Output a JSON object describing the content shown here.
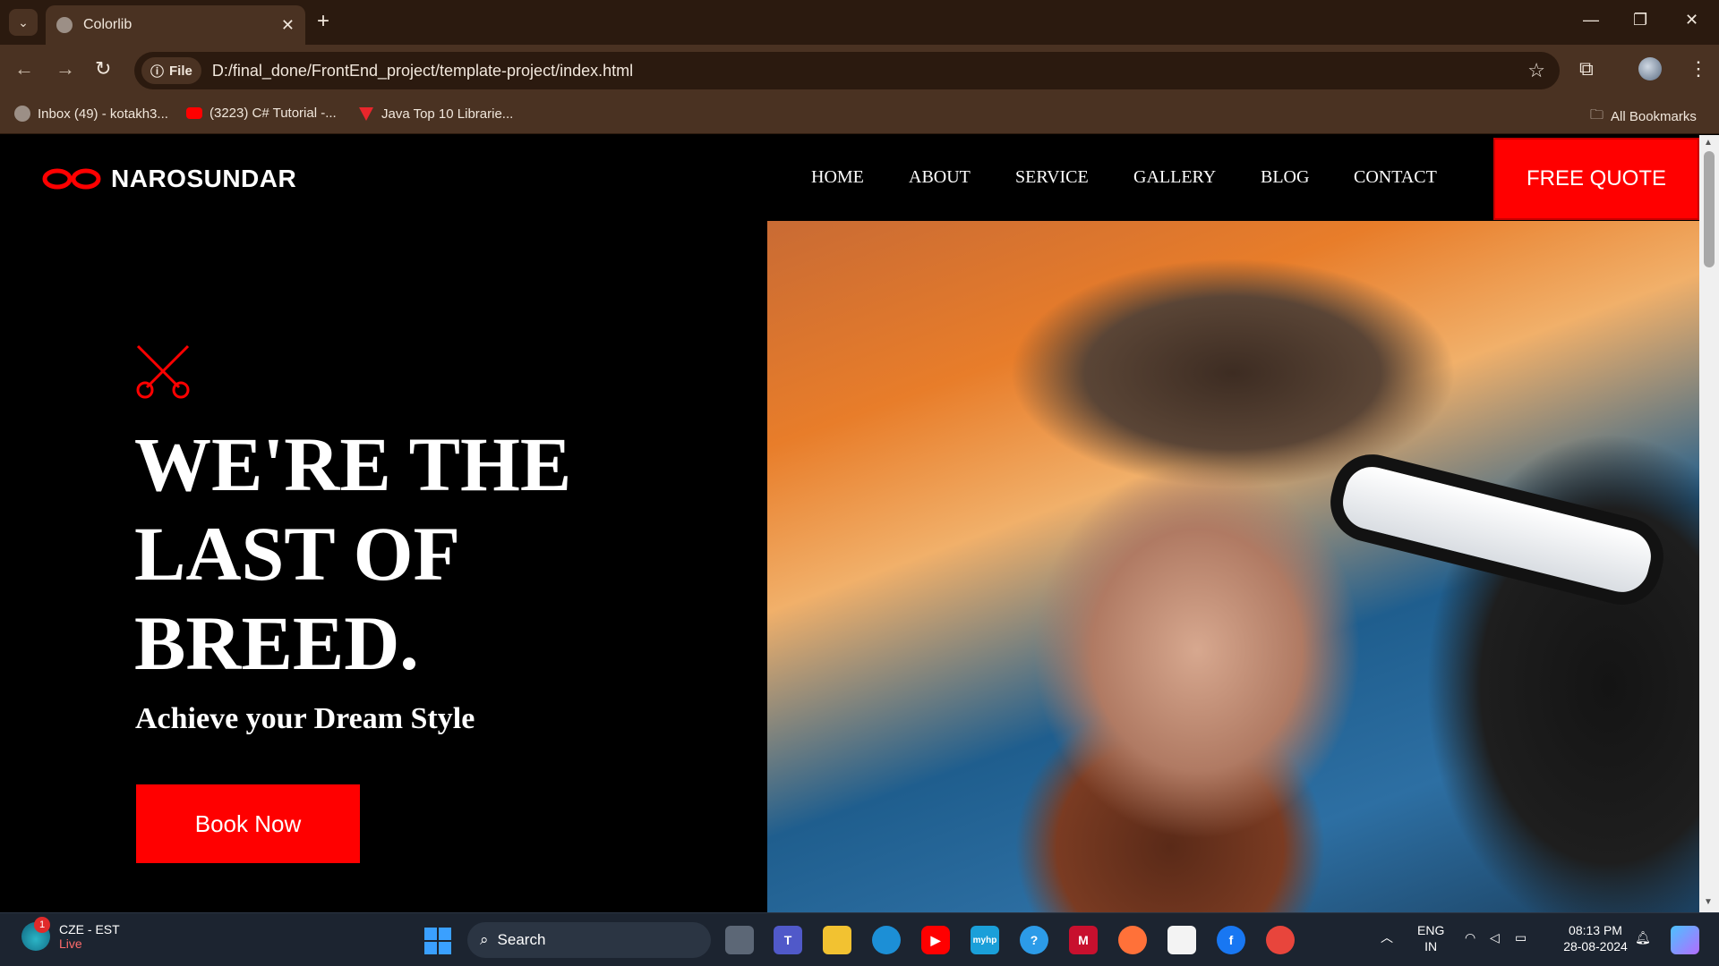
{
  "browser": {
    "tab_title": "Colorlib",
    "file_chip": "File",
    "url": "D:/final_done/FrontEnd_project/template-project/index.html",
    "bookmarks": [
      {
        "label": "Inbox (49) - kotakh3...",
        "icon": "globe-icon"
      },
      {
        "label": "(3223) C# Tutorial -...",
        "icon": "youtube-icon"
      },
      {
        "label": "Java Top 10 Librarie...",
        "icon": "vivaldi-icon"
      }
    ],
    "all_bookmarks": "All Bookmarks"
  },
  "site": {
    "brand": "NAROSUNDAR",
    "nav": [
      "HOME",
      "ABOUT",
      "SERVICE",
      "GALLERY",
      "BLOG",
      "CONTACT"
    ],
    "quote_button": "FREE QUOTE",
    "headline": [
      "WE'RE THE",
      "LAST OF",
      "BREED."
    ],
    "subheadline": "Achieve your Dream Style",
    "book_button": "Book Now",
    "accent_color": "#ff0000"
  },
  "taskbar": {
    "weather_location": "CZE - EST",
    "weather_status": "Live",
    "weather_badge": "1",
    "search_label": "Search",
    "language_top": "ENG",
    "language_bottom": "IN",
    "time": "08:13 PM",
    "date": "28-08-2024"
  }
}
